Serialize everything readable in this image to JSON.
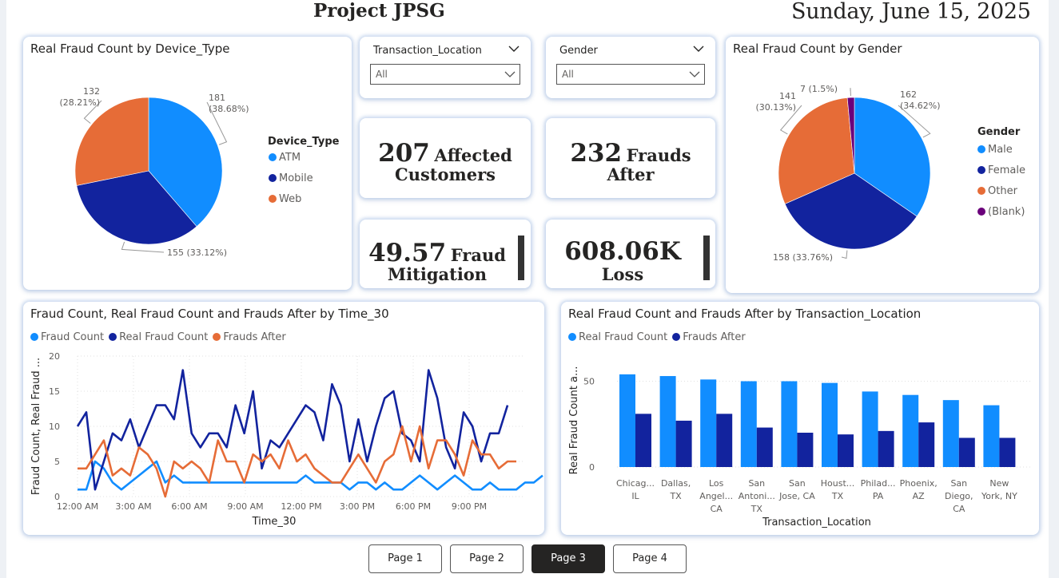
{
  "header": {
    "title": "Project JPSG",
    "date": "Sunday, June 15, 2025"
  },
  "device_pie": {
    "title": "Real Fraud Count by Device_Type",
    "legend_title": "Device_Type",
    "labels": [
      "181\n(38.68%)",
      "155 (33.12%)",
      "132\n(28.21%)"
    ]
  },
  "gender_pie": {
    "title": "Real Fraud Count by Gender",
    "legend_title": "Gender",
    "labels": [
      "162\n(34.62%)",
      "158 (33.76%)",
      "141\n(30.13%)",
      "7 (1.5%)"
    ]
  },
  "slicers": {
    "location": {
      "label": "Transaction_Location",
      "value": "All"
    },
    "gender": {
      "label": "Gender",
      "value": "All"
    }
  },
  "kpis": {
    "affected": {
      "value": "207",
      "label1": "Affected",
      "label2": "Customers"
    },
    "frauds_after": {
      "value": "232",
      "label1": "Frauds",
      "label2": "After"
    },
    "mitigation": {
      "value": "49.57",
      "label1": "Fraud",
      "label2": "Mitigation"
    },
    "loss": {
      "value": "608.06K",
      "label2": "Loss"
    }
  },
  "line_chart": {
    "title": "Fraud Count, Real Fraud Count and Frauds After by Time_30",
    "ylabel": "Fraud Count, Real Fraud ...",
    "xlabel": "Time_30"
  },
  "bar_chart": {
    "title": "Real Fraud Count and Frauds After by Transaction_Location",
    "ylabel": "Real Fraud Count a...",
    "xlabel": "Transaction_Location"
  },
  "pager": {
    "pages": [
      "Page 1",
      "Page 2",
      "Page 3",
      "Page 4"
    ],
    "active": 2
  },
  "colors": {
    "light_blue": "#118dff",
    "dark_blue": "#12239e",
    "orange": "#e66c37",
    "purple": "#6b007b"
  },
  "chart_data": [
    {
      "type": "pie",
      "title": "Real Fraud Count by Device_Type",
      "categories": [
        "ATM",
        "Mobile",
        "Web"
      ],
      "values": [
        181,
        155,
        132
      ],
      "percents": [
        38.68,
        33.12,
        28.21
      ],
      "colors": [
        "#118dff",
        "#12239e",
        "#e66c37"
      ],
      "legend": "right"
    },
    {
      "type": "pie",
      "title": "Real Fraud Count by Gender",
      "categories": [
        "Male",
        "Female",
        "Other",
        "(Blank)"
      ],
      "values": [
        162,
        158,
        141,
        7
      ],
      "percents": [
        34.62,
        33.76,
        30.13,
        1.5
      ],
      "colors": [
        "#118dff",
        "#12239e",
        "#e66c37",
        "#6b007b"
      ],
      "legend": "right"
    },
    {
      "type": "line",
      "title": "Fraud Count, Real Fraud Count and Frauds After by Time_30",
      "xlabel": "Time_30",
      "ylabel": "Fraud Count, Real Fraud ...",
      "x_ticks": [
        "12:00 AM",
        "3:00 AM",
        "6:00 AM",
        "9:00 AM",
        "12:00 PM",
        "3:00 PM",
        "6:00 PM",
        "9:00 PM"
      ],
      "ylim": [
        0,
        20
      ],
      "y_ticks": [
        0,
        5,
        10,
        15,
        20
      ],
      "grid": true,
      "legend": "top-left",
      "series": [
        {
          "name": "Fraud Count",
          "color": "#118dff",
          "values": [
            1,
            1,
            5,
            4,
            2,
            1,
            2,
            3,
            4,
            5,
            2,
            3,
            2,
            2,
            2,
            2,
            2,
            2,
            2,
            2,
            2,
            2,
            2,
            2,
            2,
            2,
            3,
            2,
            2,
            2,
            2,
            1,
            2,
            2,
            1,
            2,
            1,
            1,
            2,
            3,
            2,
            1,
            2,
            3,
            2,
            1,
            1,
            2,
            1,
            1,
            1,
            2,
            2,
            3
          ]
        },
        {
          "name": "Real Fraud Count",
          "color": "#12239e",
          "values": [
            10,
            12,
            1,
            5,
            9,
            8,
            11,
            7,
            10,
            13,
            13,
            11,
            18,
            9,
            7,
            9,
            9,
            7,
            13,
            9,
            15,
            4,
            8,
            7,
            9,
            11,
            13,
            12,
            8,
            16,
            13,
            5,
            11,
            5,
            10,
            14,
            15,
            9,
            8,
            5,
            18,
            14,
            7,
            4,
            12,
            10,
            5,
            9,
            9,
            13
          ]
        },
        {
          "name": "Frauds After",
          "color": "#e66c37",
          "values": [
            4,
            4,
            6,
            8,
            3,
            4,
            3,
            7,
            6,
            4,
            0,
            5,
            4,
            5,
            4,
            2,
            8,
            5,
            5,
            2,
            6,
            5,
            6,
            4,
            8,
            5,
            6,
            4,
            3,
            2,
            2,
            4,
            6,
            4,
            2,
            5,
            6,
            10,
            5,
            10,
            4,
            8,
            8,
            6,
            3,
            8,
            6,
            6,
            4,
            5,
            5
          ]
        }
      ]
    },
    {
      "type": "bar",
      "title": "Real Fraud Count and Frauds After by Transaction_Location",
      "xlabel": "Transaction_Location",
      "ylabel": "Real Fraud Count a...",
      "categories": [
        "Chicag... IL",
        "Dallas, TX",
        "Los Angel... CA",
        "San Antoni... TX",
        "San Jose, CA",
        "Houst... TX",
        "Philad... PA",
        "Phoenix, AZ",
        "San Diego, CA",
        "New York, NY"
      ],
      "category_lines": [
        [
          "Chicag...",
          "IL"
        ],
        [
          "Dallas,",
          "TX"
        ],
        [
          "Los",
          "Angel...",
          "CA"
        ],
        [
          "San",
          "Antoni...",
          "TX"
        ],
        [
          "San",
          "Jose, CA"
        ],
        [
          "Houst...",
          "TX"
        ],
        [
          "Philad...",
          "PA"
        ],
        [
          "Phoenix,",
          "AZ"
        ],
        [
          "San",
          "Diego,",
          "CA"
        ],
        [
          "New",
          "York, NY"
        ]
      ],
      "ylim": [
        0,
        60
      ],
      "y_ticks": [
        0,
        50
      ],
      "legend": "top-left",
      "series": [
        {
          "name": "Real Fraud Count",
          "color": "#118dff",
          "values": [
            54,
            53,
            51,
            50,
            50,
            49,
            44,
            42,
            39,
            36
          ]
        },
        {
          "name": "Frauds After",
          "color": "#12239e",
          "values": [
            31,
            27,
            31,
            23,
            20,
            19,
            21,
            26,
            17,
            17
          ]
        }
      ]
    }
  ]
}
